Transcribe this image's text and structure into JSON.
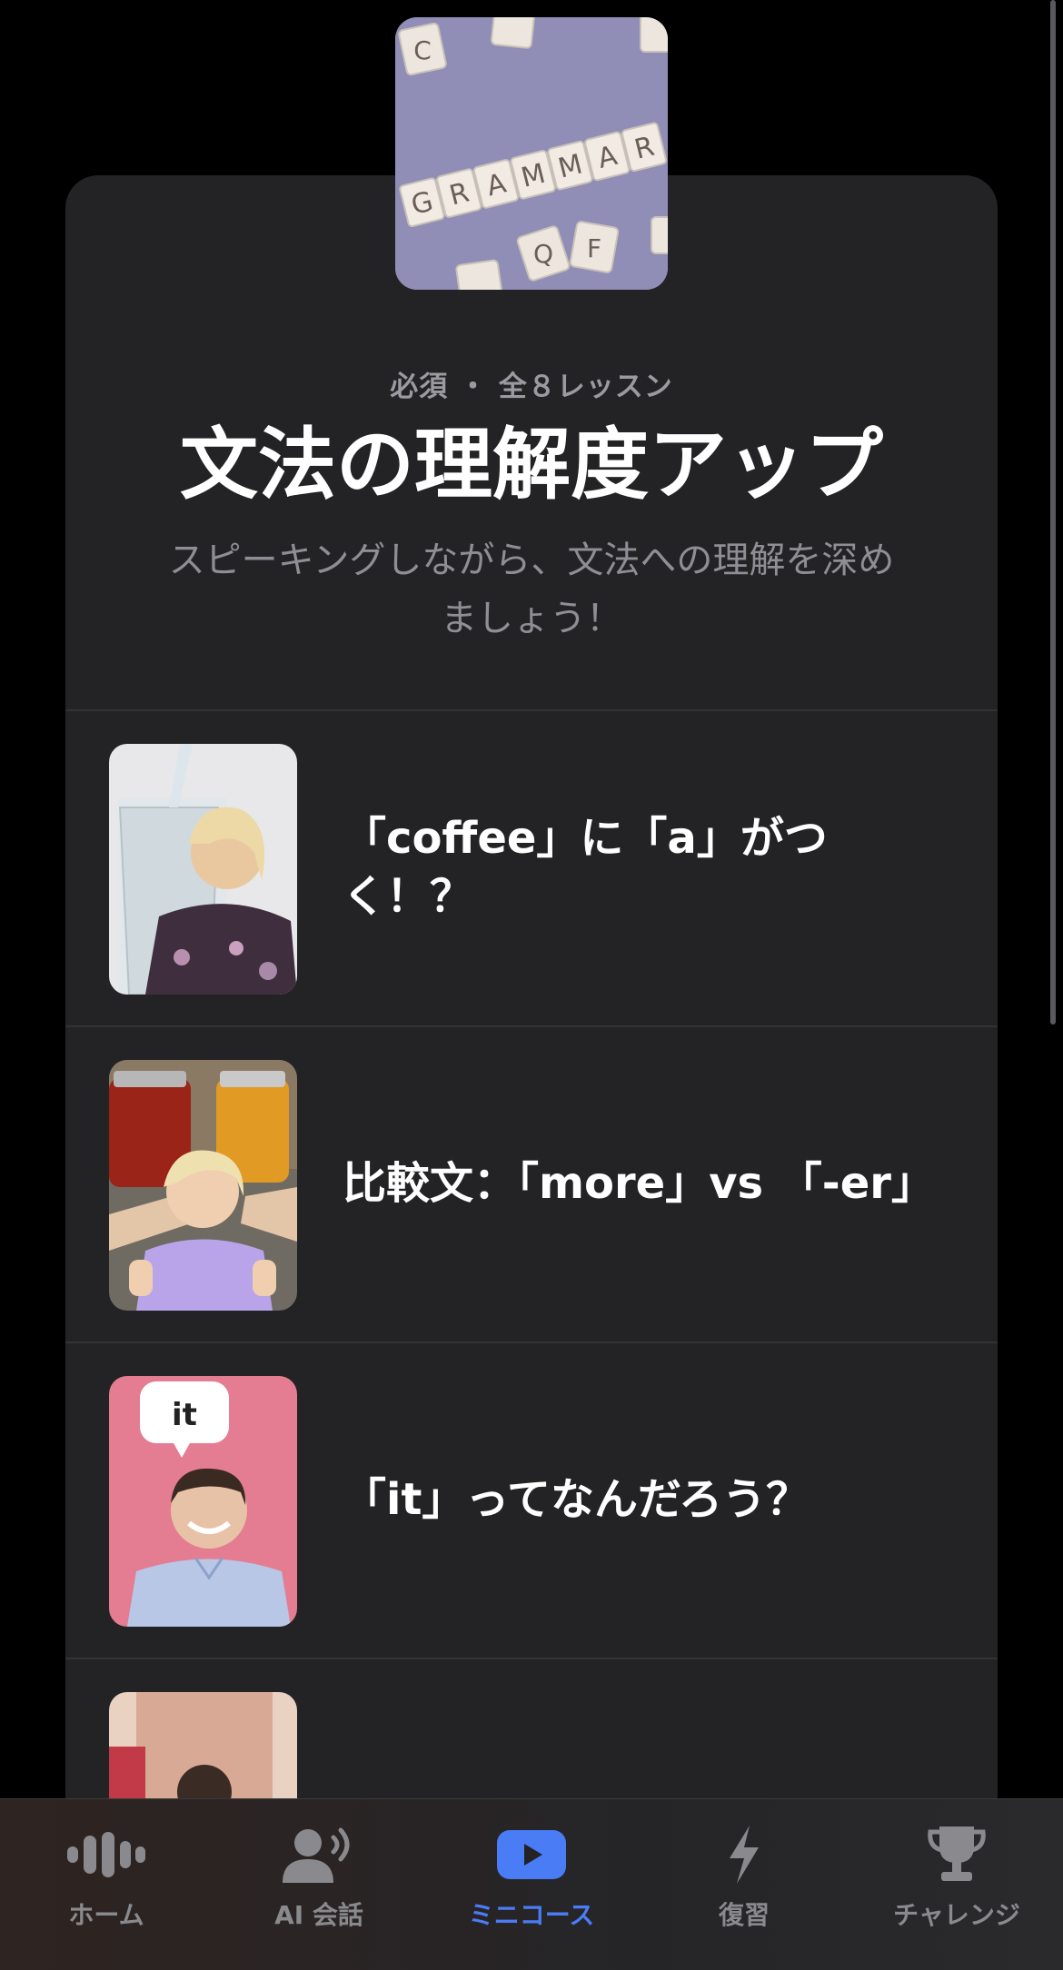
{
  "hero": {
    "tiles_text": "GRAMMAR"
  },
  "course": {
    "meta": "必須 ・ 全８レッスン",
    "title": "文法の理解度アップ",
    "subtitle": "スピーキングしながら、文法への理解を深めましょう！"
  },
  "lessons": [
    {
      "title": "「coffee」に「a」がつく！？"
    },
    {
      "title": "比較文：「more」vs 「-er」"
    },
    {
      "title": "「it」ってなんだろう？",
      "thumb_bubble": "it"
    },
    {
      "title": ""
    }
  ],
  "tabbar": {
    "active_color": "#4a7cf6",
    "inactive_color": "#8a8a8e",
    "items": [
      {
        "label": "ホーム",
        "icon": "waveform-icon"
      },
      {
        "label": "AI 会話",
        "icon": "person-speaking-icon"
      },
      {
        "label": "ミニコース",
        "icon": "play-icon",
        "active": true
      },
      {
        "label": "復習",
        "icon": "lightning-icon"
      },
      {
        "label": "チャレンジ",
        "icon": "trophy-icon"
      }
    ]
  }
}
